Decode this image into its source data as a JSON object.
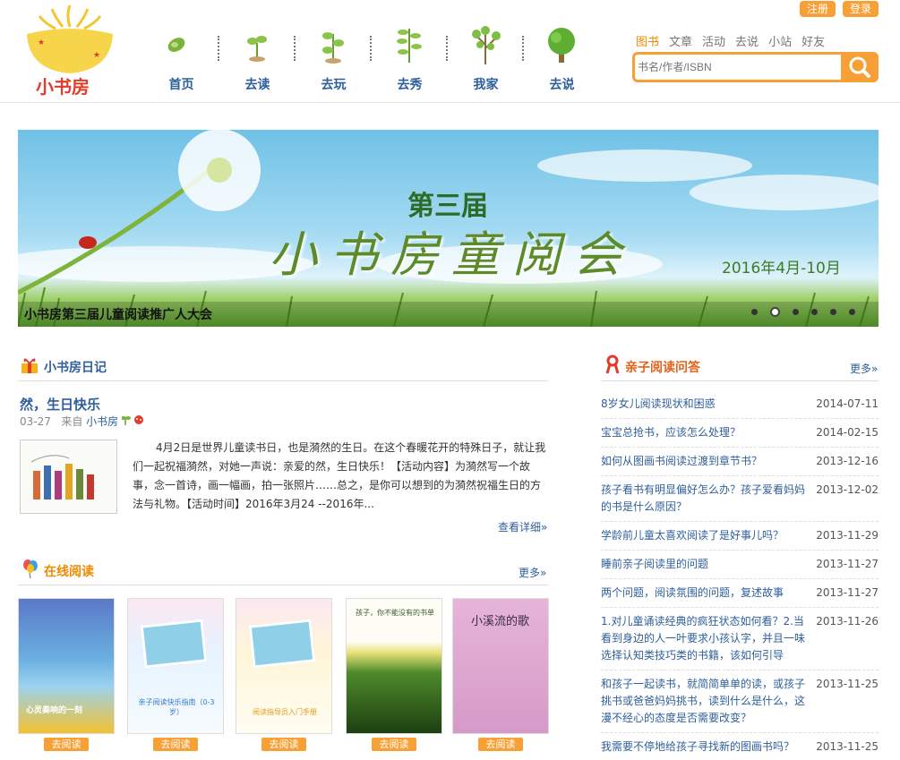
{
  "header": {
    "logo_text": "小书房",
    "top_buttons": [
      "注册",
      "登录"
    ],
    "nav": [
      "首页",
      "去读",
      "去玩",
      "去秀",
      "我家",
      "去说"
    ],
    "search_tabs": [
      "图书",
      "文章",
      "活动",
      "去说",
      "小站",
      "好友"
    ],
    "search_placeholder": "书名/作者/ISBN"
  },
  "banner": {
    "edition": "第三届",
    "title": "小书房童阅会",
    "date": "2016年4月-10月",
    "caption": "小书房第三届儿童阅读推广人大会",
    "dots_count": 6,
    "active_dot": 1
  },
  "diary": {
    "section_title": "小书房日记",
    "post_title": "然，生日快乐",
    "date": "03-27",
    "from_label": "来自",
    "author": "小书房",
    "excerpt": "4月2日是世界儿童读书日，也是漪然的生日。在这个春暖花开的特殊日子，就让我们一起祝福漪然，对她一声说：亲爱的然，生日快乐！【活动内容】为漪然写一个故事，念一首诗，画一幅画，拍一张照片……总之，是你可以想到的为漪然祝福生日的方法与礼物。【活动时间】2016年3月24 --2016年...",
    "detail_link": "查看详细»"
  },
  "online": {
    "section_title": "在线阅读",
    "more": "更多»",
    "read_label": "去阅读",
    "books": [
      {
        "cover_text": "心灵奏响的一刻"
      },
      {
        "cover_text": "亲子阅读快乐指南（0-3岁）"
      },
      {
        "cover_text": "阅读指导员入门手册"
      },
      {
        "cover_text": "孩子，你不能没有的书单"
      },
      {
        "cover_text": "小溪流的歌"
      }
    ]
  },
  "qa": {
    "section_title": "亲子阅读问答",
    "more": "更多»",
    "items": [
      {
        "q": "8岁女儿阅读现状和困惑",
        "d": "2014-07-11"
      },
      {
        "q": "宝宝总抢书，应该怎么处理？",
        "d": "2014-02-15"
      },
      {
        "q": "如何从图画书阅读过渡到章节书？",
        "d": "2013-12-16"
      },
      {
        "q": "孩子看书有明显偏好怎么办？孩子爱看妈妈的书是什么原因？",
        "d": "2013-12-02"
      },
      {
        "q": "学龄前儿童太喜欢阅读了是好事儿吗？",
        "d": "2013-11-29"
      },
      {
        "q": "睡前亲子阅读里的问题",
        "d": "2013-11-27"
      },
      {
        "q": "两个问题，阅读氛围的问题，复述故事",
        "d": "2013-11-27"
      },
      {
        "q": "1.对儿童诵读经典的疯狂状态如何看？2.当看到身边的人一叶要求小孩认字，并且一味选择认知类技巧类的书籍，该如何引导",
        "d": "2013-11-26"
      },
      {
        "q": "和孩子一起读书，就简简单单的读，或孩子挑书或爸爸妈妈挑书，读到什么是什么，这漫不经心的态度是否需要改变？",
        "d": "2013-11-25"
      },
      {
        "q": "我需要不停地给孩子寻找新的图画书吗？",
        "d": "2013-11-25"
      }
    ]
  }
}
